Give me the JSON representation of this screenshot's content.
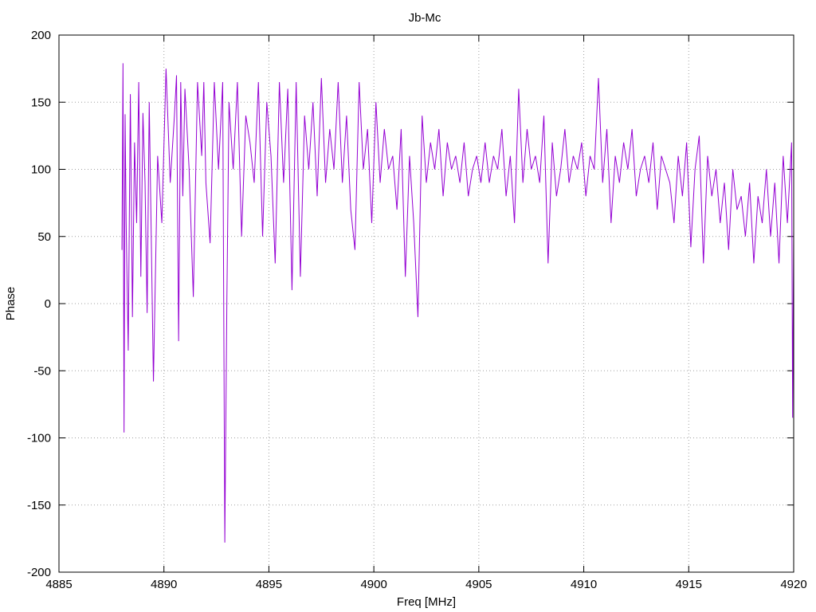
{
  "chart_data": {
    "type": "line",
    "title": "Jb-Mc",
    "xlabel": "Freq [MHz]",
    "ylabel": "Phase",
    "xlim": [
      4885,
      4920
    ],
    "ylim": [
      -200,
      200
    ],
    "x_ticks": [
      4885,
      4890,
      4895,
      4900,
      4905,
      4910,
      4915,
      4920
    ],
    "y_ticks": [
      -200,
      -150,
      -100,
      -50,
      0,
      50,
      100,
      150,
      200
    ],
    "grid": true,
    "legend": "none",
    "series": [
      {
        "color": "#9400d3",
        "x": [
          4888.0,
          4888.05,
          4888.1,
          4888.15,
          4888.2,
          4888.3,
          4888.4,
          4888.5,
          4888.6,
          4888.7,
          4888.8,
          4888.9,
          4889.0,
          4889.1,
          4889.2,
          4889.3,
          4889.5,
          4889.7,
          4889.9,
          4890.1,
          4890.3,
          4890.5,
          4890.6,
          4890.7,
          4890.8,
          4890.9,
          4891.0,
          4891.2,
          4891.4,
          4891.6,
          4891.8,
          4891.9,
          4892.0,
          4892.2,
          4892.4,
          4892.6,
          4892.8,
          4892.9,
          4893.0,
          4893.1,
          4893.3,
          4893.5,
          4893.7,
          4893.9,
          4894.1,
          4894.3,
          4894.5,
          4894.7,
          4894.9,
          4895.1,
          4895.3,
          4895.5,
          4895.7,
          4895.9,
          4896.1,
          4896.3,
          4896.5,
          4896.7,
          4896.9,
          4897.1,
          4897.3,
          4897.5,
          4897.7,
          4897.9,
          4898.1,
          4898.3,
          4898.5,
          4898.7,
          4898.9,
          4899.1,
          4899.3,
          4899.5,
          4899.7,
          4899.9,
          4900.1,
          4900.3,
          4900.5,
          4900.7,
          4900.9,
          4901.1,
          4901.3,
          4901.5,
          4901.7,
          4901.9,
          4902.1,
          4902.3,
          4902.5,
          4902.7,
          4902.9,
          4903.1,
          4903.3,
          4903.5,
          4903.7,
          4903.9,
          4904.1,
          4904.3,
          4904.5,
          4904.7,
          4904.9,
          4905.1,
          4905.3,
          4905.5,
          4905.7,
          4905.9,
          4906.1,
          4906.3,
          4906.5,
          4906.7,
          4906.9,
          4907.1,
          4907.3,
          4907.5,
          4907.7,
          4907.9,
          4908.1,
          4908.3,
          4908.5,
          4908.7,
          4908.9,
          4909.1,
          4909.3,
          4909.5,
          4909.7,
          4909.9,
          4910.1,
          4910.3,
          4910.5,
          4910.7,
          4910.9,
          4911.1,
          4911.3,
          4911.5,
          4911.7,
          4911.9,
          4912.1,
          4912.3,
          4912.5,
          4912.7,
          4912.9,
          4913.1,
          4913.3,
          4913.5,
          4913.7,
          4913.9,
          4914.1,
          4914.3,
          4914.5,
          4914.7,
          4914.9,
          4915.1,
          4915.3,
          4915.5,
          4915.7,
          4915.9,
          4916.1,
          4916.3,
          4916.5,
          4916.7,
          4916.9,
          4917.1,
          4917.3,
          4917.5,
          4917.7,
          4917.9,
          4918.1,
          4918.3,
          4918.5,
          4918.7,
          4918.9,
          4919.1,
          4919.3,
          4919.5,
          4919.7,
          4919.9,
          4919.95,
          4920.0
        ],
        "y": [
          40,
          179,
          -96,
          141,
          60,
          -35,
          156,
          -10,
          120,
          60,
          165,
          20,
          142,
          90,
          -7,
          150,
          -58,
          110,
          60,
          175,
          90,
          140,
          170,
          -28,
          165,
          80,
          160,
          100,
          5,
          165,
          110,
          165,
          90,
          45,
          165,
          100,
          165,
          -178,
          5,
          150,
          100,
          165,
          50,
          140,
          120,
          90,
          165,
          50,
          150,
          110,
          30,
          165,
          90,
          160,
          10,
          165,
          20,
          140,
          100,
          150,
          80,
          168,
          90,
          130,
          100,
          165,
          90,
          140,
          70,
          40,
          165,
          100,
          130,
          60,
          150,
          90,
          130,
          100,
          110,
          70,
          130,
          20,
          110,
          60,
          -10,
          140,
          90,
          120,
          100,
          130,
          80,
          120,
          100,
          110,
          90,
          120,
          80,
          100,
          110,
          90,
          120,
          90,
          110,
          100,
          130,
          80,
          110,
          60,
          160,
          90,
          130,
          100,
          110,
          90,
          140,
          30,
          120,
          80,
          100,
          130,
          90,
          110,
          100,
          120,
          80,
          110,
          100,
          168,
          90,
          130,
          60,
          110,
          90,
          120,
          100,
          130,
          80,
          100,
          110,
          90,
          120,
          70,
          110,
          100,
          90,
          60,
          110,
          80,
          120,
          42,
          100,
          125,
          30,
          110,
          80,
          100,
          60,
          90,
          40,
          100,
          70,
          80,
          50,
          90,
          30,
          80,
          60,
          100,
          50,
          90,
          30,
          110,
          60,
          120,
          -85,
          55
        ]
      }
    ]
  }
}
